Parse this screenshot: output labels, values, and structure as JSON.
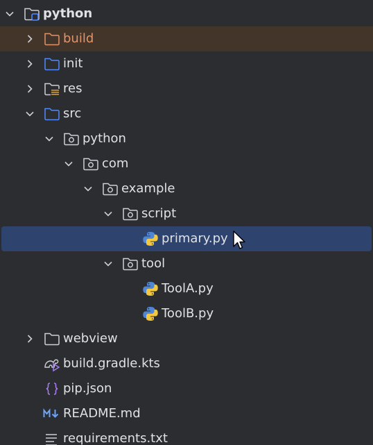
{
  "project_tree": {
    "rows": [
      {
        "label": "python",
        "icon": "module-folder-icon",
        "expanded": true
      },
      {
        "label": "build",
        "icon": "excluded-folder-icon",
        "expanded": false
      },
      {
        "label": "init",
        "icon": "folder-icon",
        "expanded": false
      },
      {
        "label": "res",
        "icon": "resources-folder-icon",
        "expanded": false
      },
      {
        "label": "src",
        "icon": "folder-icon",
        "expanded": true
      },
      {
        "label": "python",
        "icon": "package-folder-icon",
        "expanded": true
      },
      {
        "label": "com",
        "icon": "package-folder-icon",
        "expanded": true
      },
      {
        "label": "example",
        "icon": "package-folder-icon",
        "expanded": true
      },
      {
        "label": "script",
        "icon": "package-folder-icon",
        "expanded": true
      },
      {
        "label": "primary.py",
        "icon": "python-file-icon",
        "selected": true
      },
      {
        "label": "tool",
        "icon": "package-folder-icon",
        "expanded": true
      },
      {
        "label": "ToolA.py",
        "icon": "python-file-icon"
      },
      {
        "label": "ToolB.py",
        "icon": "python-file-icon"
      },
      {
        "label": "webview",
        "icon": "folder-icon",
        "expanded": false
      },
      {
        "label": "build.gradle.kts",
        "icon": "gradle-file-icon"
      },
      {
        "label": "pip.json",
        "icon": "json-file-icon"
      },
      {
        "label": "README.md",
        "icon": "markdown-file-icon"
      },
      {
        "label": "requirements.txt",
        "icon": "text-file-icon"
      }
    ]
  },
  "colors": {
    "background": "#2b2d30",
    "selection": "#2e436e",
    "excluded_highlight": "#43352a",
    "excluded_text": "#e0946a",
    "folder_blue": "#548af7",
    "text": "#dfe1e5"
  }
}
